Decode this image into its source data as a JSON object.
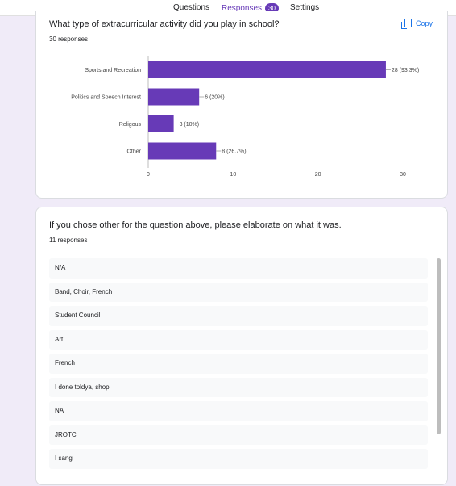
{
  "tabs": [
    {
      "label": "Questions"
    },
    {
      "label": "Responses",
      "badge": "30"
    },
    {
      "label": "Settings"
    }
  ],
  "accent_color": "#673ab7",
  "question1": {
    "title": "What type of extracurricular activity did you play in school?",
    "responses": "30 responses",
    "copy_label": "Copy",
    "copy_icon": "copy-icon"
  },
  "chart_data": {
    "type": "bar",
    "orientation": "horizontal",
    "categories": [
      "Sports and Recreation",
      "Politics and Speech Interest",
      "Religous",
      "Other"
    ],
    "values": [
      28,
      6,
      3,
      8
    ],
    "value_labels": [
      "28 (93.3%)",
      "6 (20%)",
      "3 (10%)",
      "8 (26.7%)"
    ],
    "xlim": [
      0,
      30
    ],
    "xticks": [
      0,
      10,
      20,
      30
    ],
    "bar_color": "#673ab7",
    "grid": false
  },
  "question2": {
    "title": "If you chose other for the question above, please elaborate on what it was.",
    "responses": "11 responses",
    "answers": [
      "N/A",
      "Band, Choir, French",
      "Student Council",
      "Art",
      "French",
      "I done toldya, shop",
      "NA",
      "JROTC",
      "I sang"
    ]
  }
}
